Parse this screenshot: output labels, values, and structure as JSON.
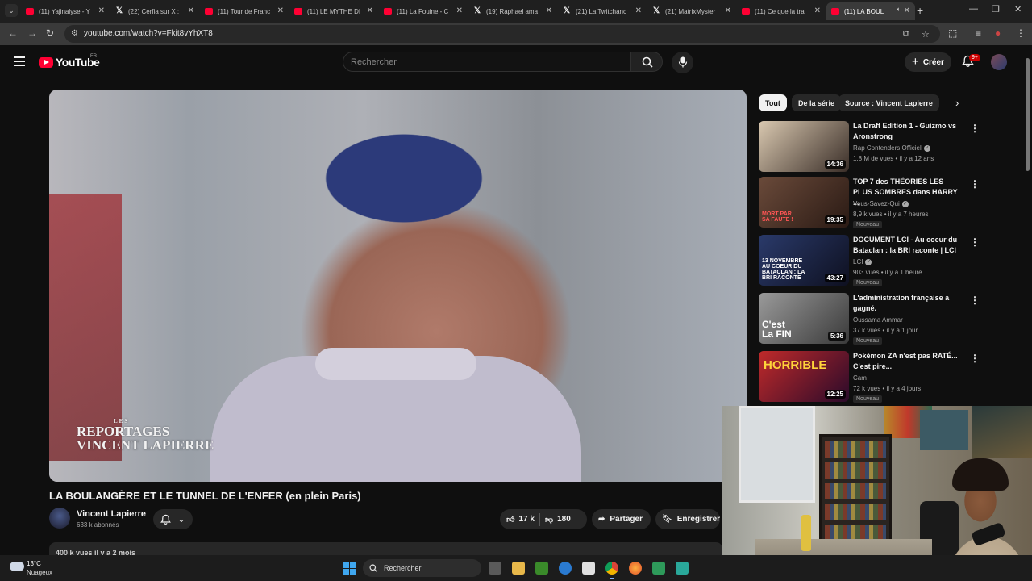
{
  "browser": {
    "tabs": [
      {
        "title": "(11) Yajinalyse - Y",
        "favicon": "youtube-icon"
      },
      {
        "title": "(22) Cerfia sur X :",
        "favicon": "x-icon"
      },
      {
        "title": "(11) Tour de Franc",
        "favicon": "youtube-icon"
      },
      {
        "title": "(11) LE MYTHE DI",
        "favicon": "youtube-icon"
      },
      {
        "title": "(11) La Fouine - C",
        "favicon": "youtube-icon"
      },
      {
        "title": "(19) Raphael ama",
        "favicon": "x-icon"
      },
      {
        "title": "(21) La Twitchanc",
        "favicon": "x-icon"
      },
      {
        "title": "(21) MatrixMyster",
        "favicon": "x-icon"
      },
      {
        "title": "(11) Ce que la tra",
        "favicon": "youtube-icon"
      },
      {
        "title": "(11) LA BOUL",
        "favicon": "youtube-icon",
        "active": true
      }
    ],
    "url": "youtube.com/watch?v=Fkit8vYhXT8"
  },
  "header": {
    "logo_text": "YouTube",
    "country_code": "FR",
    "search_placeholder": "Rechercher",
    "create_label": "Créer",
    "notification_count": "9+"
  },
  "video": {
    "watermark_small": "LES",
    "watermark_line1": "REPORTAGES",
    "watermark_line2": "VINCENT LAPIERRE",
    "title": "LA BOULANGÈRE ET LE TUNNEL DE L'ENFER (en plein Paris)",
    "channel": "Vincent Lapierre",
    "subscribers": "633 k abonnés",
    "likes": "17 k",
    "dislikes": "180",
    "share_label": "Partager",
    "save_label": "Enregistrer",
    "description_peek": "400 k vues  il y a 2 mois"
  },
  "sidebar": {
    "chips": [
      "Tout",
      "De la série",
      "Source : Vincent Lapierre"
    ],
    "recommendations": [
      {
        "title": "La Draft Edition 1 - Guizmo vs Aronstrong",
        "channel": "Rap Contenders Officiel",
        "verified": true,
        "meta": "1,8 M de vues • il y a 12 ans",
        "duration": "14:36",
        "badge": "",
        "thumb_text": "",
        "thumb_colors": [
          "#d9c8b0",
          "#3a2e28"
        ]
      },
      {
        "title": "TOP 7 des THÉORIES LES PLUS SOMBRES dans HARRY ...",
        "channel": "Vous-Savez-Qui",
        "verified": true,
        "meta": "8,9 k vues • il y a 7 heures",
        "duration": "19:35",
        "badge": "Nouveau",
        "thumb_text": "MORT PAR SA FAUTE !",
        "thumb_colors": [
          "#6a4a3a",
          "#2a1a14"
        ]
      },
      {
        "title": "DOCUMENT LCI - Au coeur du Bataclan : la BRI raconte | LCI",
        "channel": "LCI",
        "verified": true,
        "meta": "903 vues • il y a 1 heure",
        "duration": "43:27",
        "badge": "Nouveau",
        "thumb_text": "13 NOVEMBRE AU COEUR DU BATACLAN : LA BRI RACONTE",
        "thumb_colors": [
          "#2a3a6a",
          "#0e1020"
        ]
      },
      {
        "title": "L'administration française a gagné.",
        "channel": "Oussama Ammar",
        "verified": false,
        "meta": "37 k vues • il y a 1 jour",
        "duration": "5:36",
        "badge": "Nouveau",
        "thumb_text": "C'est La FIN",
        "thumb_colors": [
          "#9a9a9a",
          "#3a3a3a"
        ]
      },
      {
        "title": "Pokémon ZA n'est pas RATÉ... C'est pire...",
        "channel": "Cam",
        "verified": false,
        "meta": "72 k vues • il y a 4 jours",
        "duration": "12:25",
        "badge": "Nouveau",
        "thumb_text": "HORRIBLE",
        "thumb_colors": [
          "#c02a2a",
          "#2a0a2a"
        ]
      }
    ]
  },
  "taskbar": {
    "temperature": "13°C",
    "condition": "Nuageux",
    "search_label": "Rechercher"
  },
  "colors": {
    "background": "#0f0f0f",
    "chip_bg": "#272727",
    "youtube_red": "#ff0033"
  }
}
